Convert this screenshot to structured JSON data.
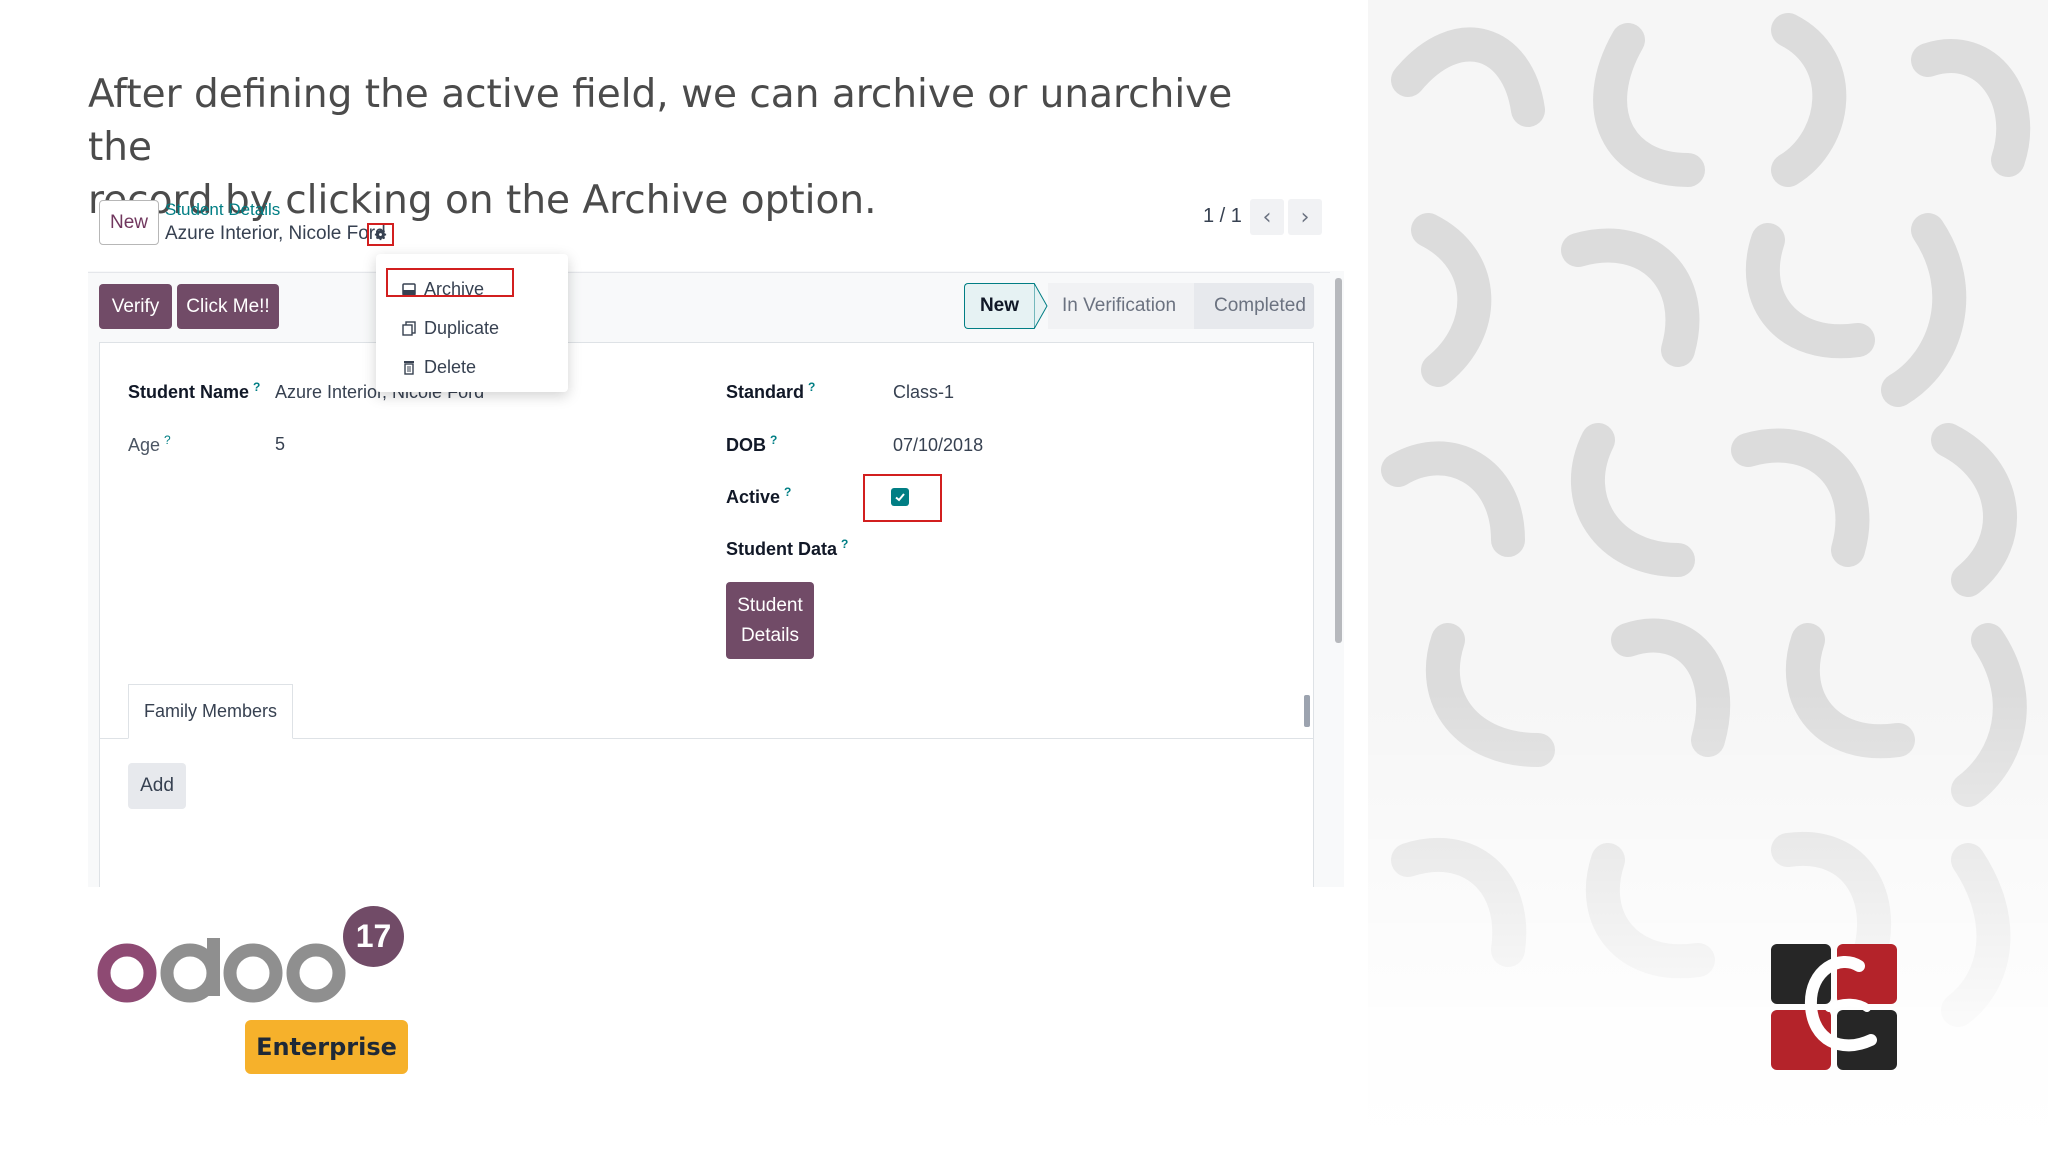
{
  "headline": {
    "line1": "After defining the active field, we can archive or unarchive the",
    "line2": "record by clicking on the Archive option."
  },
  "control_panel": {
    "new_label": "New",
    "breadcrumb_parent": "Student Details",
    "breadcrumb_current": "Azure Interior, Nicole Ford",
    "pager": "1 / 1"
  },
  "statusbar": {
    "buttons": [
      "Verify",
      "Click Me!!"
    ],
    "stages": [
      "New",
      "In Verification",
      "Completed"
    ],
    "active_stage": "New"
  },
  "dropdown": {
    "items": [
      "Archive",
      "Duplicate",
      "Delete"
    ]
  },
  "form": {
    "student_name_label": "Student Name",
    "student_name_value": "Azure Interior, Nicole Ford",
    "age_label": "Age",
    "age_value": "5",
    "standard_label": "Standard",
    "standard_value": "Class-1",
    "dob_label": "DOB",
    "dob_value": "07/10/2018",
    "active_label": "Active",
    "active_checked": true,
    "student_data_label": "Student Data",
    "student_details_btn": [
      "Student",
      "Details"
    ],
    "help_mark": "?"
  },
  "notebook": {
    "tab": "Family Members",
    "add_label": "Add"
  },
  "branding": {
    "odoo_version": "17",
    "edition": "Enterprise",
    "odoo_color": "#8f8f8f",
    "odoo_accent": "#714b67",
    "enterprise_color": "#f6b12b"
  },
  "colors": {
    "primary": "#714b67",
    "teal": "#017e84",
    "highlight_frame": "#d21f1f"
  }
}
